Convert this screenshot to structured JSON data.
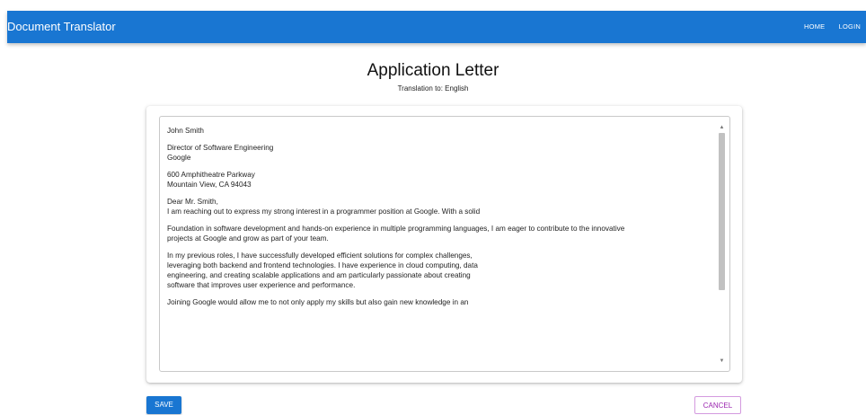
{
  "app": {
    "title": "Document Translator",
    "nav": {
      "home": "HOME",
      "login": "LOGIN"
    }
  },
  "page": {
    "title": "Application Letter",
    "subtitle": "Translation to: English"
  },
  "document": {
    "paragraphs": [
      "John Smith",
      "Director of Software Engineering\nGoogle",
      "600 Amphitheatre Parkway\nMountain View, CA 94043",
      "Dear Mr. Smith,\nI am reaching out to express my strong interest in a programmer position at Google. With a solid",
      "Foundation in software development and hands-on experience in multiple programming languages, I am eager to contribute to the innovative\nprojects at Google and grow as part of your team.",
      "In my previous roles, I have successfully developed efficient solutions for complex challenges,\nleveraging both backend and frontend technologies. I have experience in cloud computing, data\nengineering, and creating scalable applications and am particularly passionate about creating\nsoftware that improves user experience and performance.",
      "Joining Google would allow me to not only apply my skills but also gain new knowledge in an"
    ]
  },
  "actions": {
    "save": "SAVE",
    "cancel": "CANCEL"
  },
  "colors": {
    "primary": "#1976d2",
    "secondary": "#9c27b0"
  }
}
